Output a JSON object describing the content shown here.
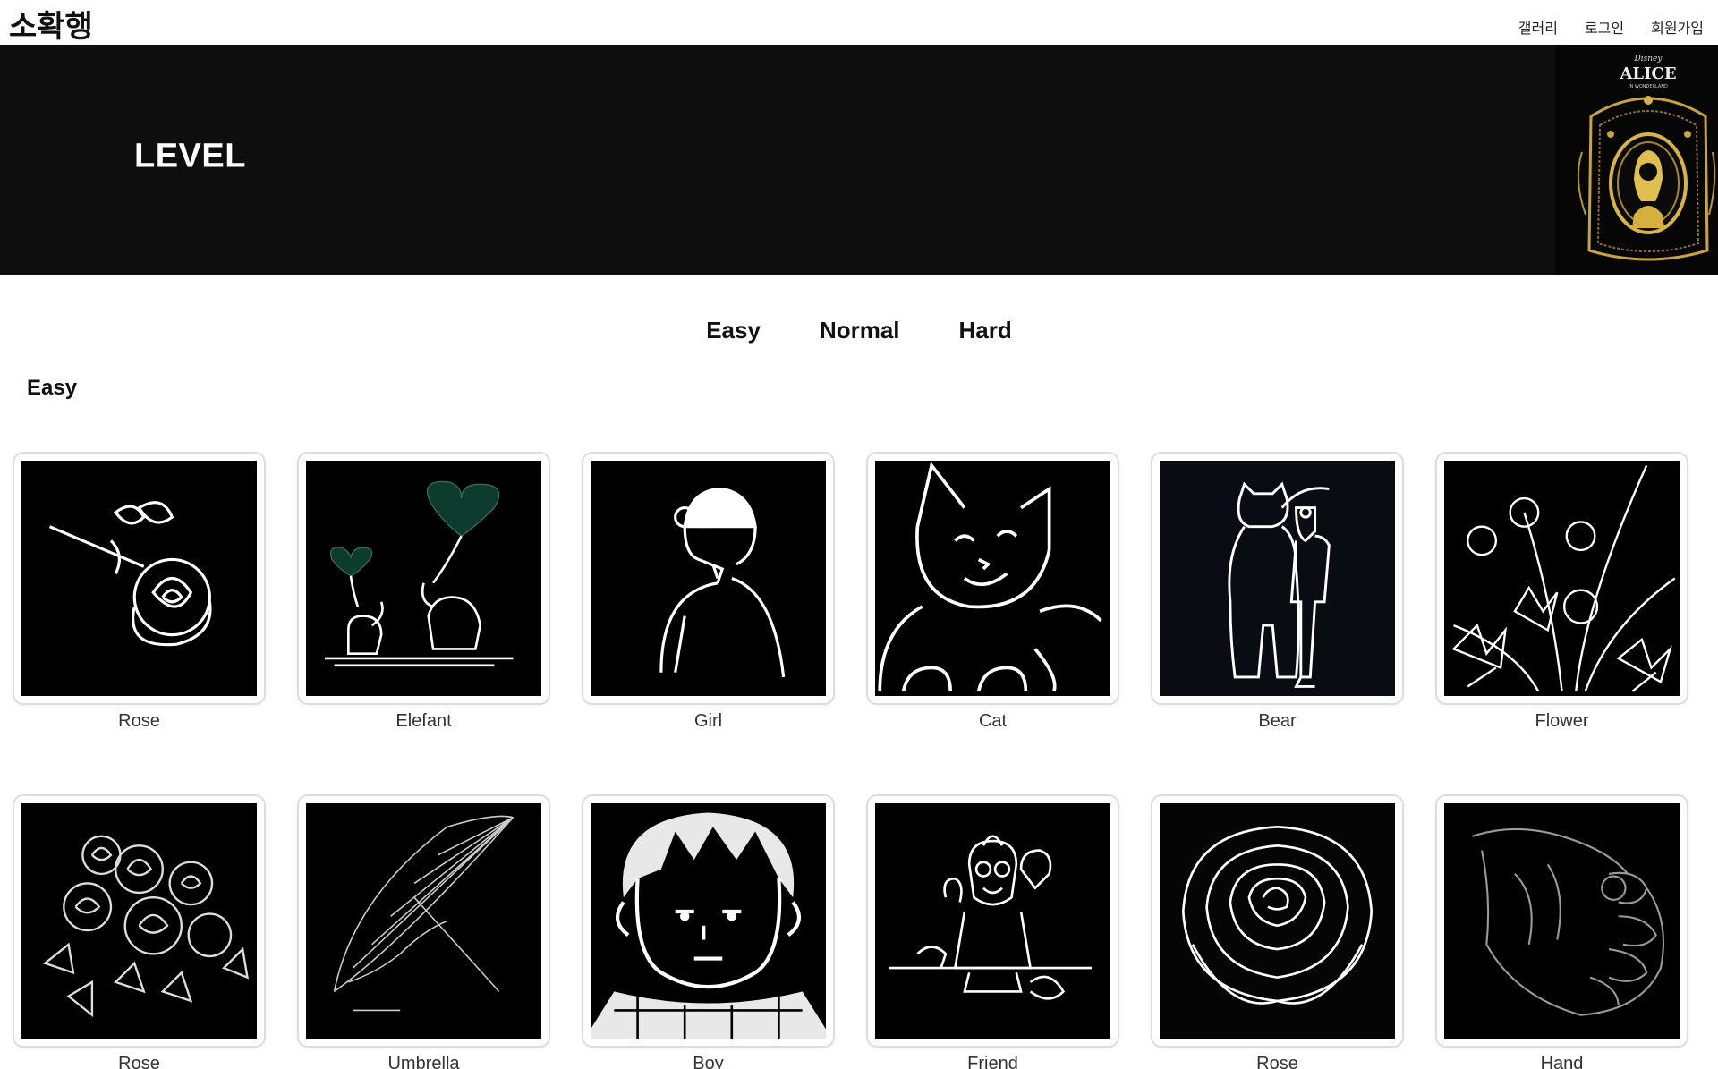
{
  "brand": {
    "logo": "소확행"
  },
  "nav": {
    "gallery": "갤러리",
    "login": "로그인",
    "signup": "회원가입"
  },
  "banner": {
    "title": "LEVEL",
    "poster": {
      "brand": "Disney",
      "title": "ALICE",
      "subtitle": "IN WONDERLAND"
    }
  },
  "levels": {
    "easy": "Easy",
    "normal": "Normal",
    "hard": "Hard"
  },
  "section": {
    "title": "Easy"
  },
  "gallery": {
    "items": [
      {
        "label": "Rose",
        "icon": "rose-drawing"
      },
      {
        "label": "Elefant",
        "icon": "elephant-drawing"
      },
      {
        "label": "Girl",
        "icon": "girl-drawing"
      },
      {
        "label": "Cat",
        "icon": "cat-drawing"
      },
      {
        "label": "Bear",
        "icon": "bear-drawing"
      },
      {
        "label": "Flower",
        "icon": "flower-drawing"
      },
      {
        "label": "Rose",
        "icon": "roses-drawing"
      },
      {
        "label": "Umbrella",
        "icon": "umbrella-drawing"
      },
      {
        "label": "Boy",
        "icon": "boy-drawing"
      },
      {
        "label": "Friend",
        "icon": "friend-drawing"
      },
      {
        "label": "Rose",
        "icon": "rose-bloom-drawing"
      },
      {
        "label": "Hand",
        "icon": "hand-drawing"
      }
    ]
  },
  "colors": {
    "banner_bg": "#0e0e0f",
    "heart_green": "#0d3b2e",
    "gold": "#c9a43a"
  }
}
